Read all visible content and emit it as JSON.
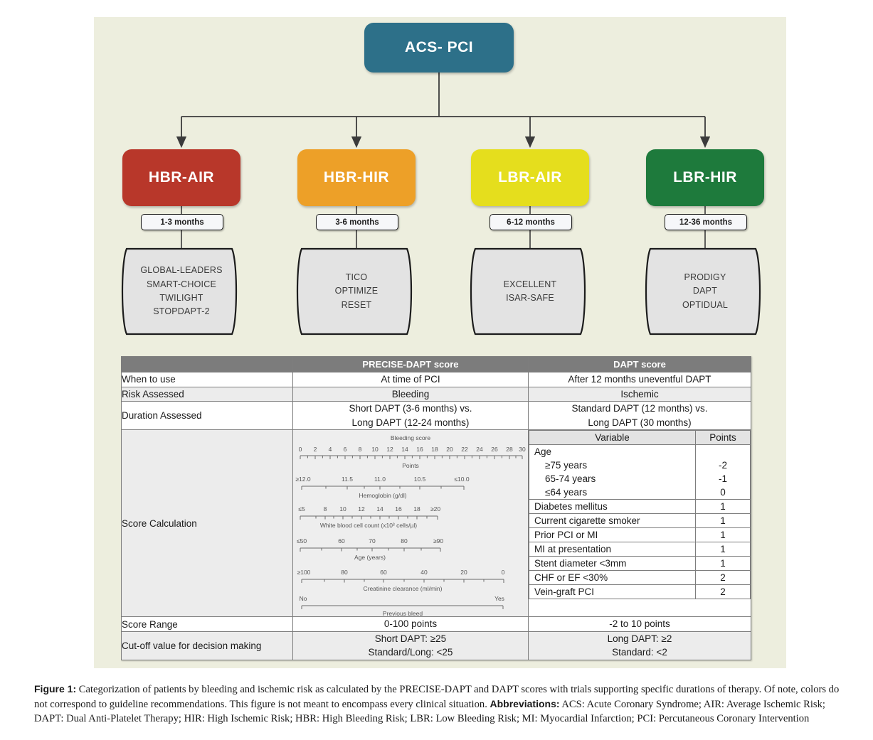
{
  "figure": {
    "root_node": {
      "label": "ACS- PCI"
    },
    "risk_nodes": [
      {
        "label": "HBR-AIR",
        "color": "#b8372a",
        "duration": "1-3 months",
        "trials": [
          "GLOBAL-LEADERS",
          "SMART-CHOICE",
          "TWILIGHT",
          "STOPDAPT-2"
        ]
      },
      {
        "label": "HBR-HIR",
        "color": "#eda028",
        "duration": "3-6 months",
        "trials": [
          "TICO",
          "OPTIMIZE",
          "RESET"
        ]
      },
      {
        "label": "LBR-AIR",
        "color": "#e5de1d",
        "duration": "6-12 months",
        "trials": [
          "EXCELLENT",
          "ISAR-SAFE"
        ]
      },
      {
        "label": "LBR-HIR",
        "color": "#1e7a3c",
        "duration": "12-36 months",
        "trials": [
          "PRODIGY",
          "DAPT",
          "OPTIDUAL"
        ]
      }
    ]
  },
  "table": {
    "headers": {
      "blank": "",
      "precise": "PRECISE-DAPT score",
      "dapt": "DAPT score"
    },
    "rows": [
      {
        "label": "When to use",
        "precise": "At time of PCI",
        "dapt": "After 12 months uneventful DAPT"
      },
      {
        "label": "Risk Assessed",
        "precise": "Bleeding",
        "dapt": "Ischemic"
      },
      {
        "label": "Duration Assessed",
        "precise_line1": "Short DAPT (3-6 months) vs.",
        "precise_line2": "Long DAPT (12-24 months)",
        "dapt_line1": "Standard DAPT (12 months) vs.",
        "dapt_line2": "Long DAPT (30 months)"
      },
      {
        "label": "Score Calculation"
      },
      {
        "label": "Score Range",
        "precise": "0-100 points",
        "dapt": "-2 to 10 points"
      },
      {
        "label": "Cut-off value for decision making",
        "precise_line1": "Short DAPT: ≥25",
        "precise_line2": "Standard/Long: <25",
        "dapt_line1": "Long DAPT: ≥2",
        "dapt_line2": "Standard: <2"
      }
    ]
  },
  "dapt_score_table": {
    "header": {
      "variable": "Variable",
      "points": "Points"
    },
    "rows": [
      {
        "variable": "Age",
        "points": "",
        "indent": false
      },
      {
        "variable": "≥75 years",
        "points": "-2",
        "indent": true
      },
      {
        "variable": "65-74 years",
        "points": "-1",
        "indent": true
      },
      {
        "variable": "≤64 years",
        "points": "0",
        "indent": true
      },
      {
        "variable": "Diabetes mellitus",
        "points": "1",
        "indent": false
      },
      {
        "variable": "Current cigarette smoker",
        "points": "1",
        "indent": false
      },
      {
        "variable": "Prior PCI or MI",
        "points": "1",
        "indent": false
      },
      {
        "variable": "MI at presentation",
        "points": "1",
        "indent": false
      },
      {
        "variable": "Stent diameter <3mm",
        "points": "1",
        "indent": false
      },
      {
        "variable": "CHF or EF <30%",
        "points": "2",
        "indent": false
      },
      {
        "variable": "Vein-graft PCI",
        "points": "2",
        "indent": false
      }
    ]
  },
  "chart_data": {
    "type": "nomogram",
    "title": "PRECISE-DAPT score calculation nomogram",
    "scales": [
      {
        "name": "Bleeding score",
        "title_above": "Bleeding score",
        "caption_below": "Points",
        "labels": [
          "0",
          "2",
          "4",
          "6",
          "8",
          "10",
          "12",
          "14",
          "16",
          "18",
          "20",
          "22",
          "24",
          "26",
          "28",
          "30"
        ],
        "min": 0,
        "max": 30,
        "minor_step": 1,
        "major_step": 2,
        "reversed": false
      },
      {
        "name": "Hemoglobin",
        "title_above": "",
        "caption_below": "Hemoglobin (g/dl)",
        "labels": [
          "≥12.0",
          "11.5",
          "11.0",
          "10.5",
          "≤10.0"
        ],
        "min": 10.0,
        "max": 12.0,
        "minor_step": 0.25,
        "major_step": 0.5,
        "reversed": true
      },
      {
        "name": "White blood cell count",
        "title_above": "",
        "caption_below": "White blood cell count (x10³ cells/µl)",
        "labels": [
          "≤5",
          "8",
          "10",
          "12",
          "14",
          "16",
          "18",
          "≥20"
        ],
        "min": 5,
        "max": 20,
        "minor_step": 1,
        "major_step": 2,
        "reversed": false
      },
      {
        "name": "Age",
        "title_above": "",
        "caption_below": "Age (years)",
        "labels": [
          "≤50",
          "60",
          "70",
          "80",
          "≥90"
        ],
        "min": 50,
        "max": 90,
        "minor_step": 5,
        "major_step": 10,
        "reversed": false
      },
      {
        "name": "Creatinine clearance",
        "title_above": "",
        "caption_below": "Creatinine clearance (ml/min)",
        "labels": [
          "≥100",
          "80",
          "60",
          "40",
          "20",
          "0"
        ],
        "min": 0,
        "max": 100,
        "minor_step": 5,
        "major_step": 20,
        "reversed": true
      },
      {
        "name": "Previous bleed",
        "title_above": "",
        "caption_below": "Previous bleed",
        "labels": [
          "No",
          "Yes"
        ],
        "min": 0,
        "max": 1,
        "minor_step": 1,
        "major_step": 1,
        "reversed": false
      }
    ]
  },
  "caption": {
    "figure_label": "Figure 1:",
    "body_1": " Categorization of patients by bleeding and ischemic risk as calculated by the PRECISE-DAPT and DAPT scores with trials supporting specific durations of therapy. Of note, colors do not correspond to guideline recommendations. This figure is not meant to encompass every clinical situation. ",
    "abbrev_label": "Abbreviations:",
    "body_2": " ACS: Acute Coronary Syndrome; AIR: Average Ischemic Risk; DAPT: Dual Anti-Platelet Therapy; HIR: High Ischemic Risk; HBR: High Bleeding Risk; LBR: Low Bleeding Risk; MI: Myocardial Infarction; PCI: Percutaneous Coronary Intervention"
  }
}
